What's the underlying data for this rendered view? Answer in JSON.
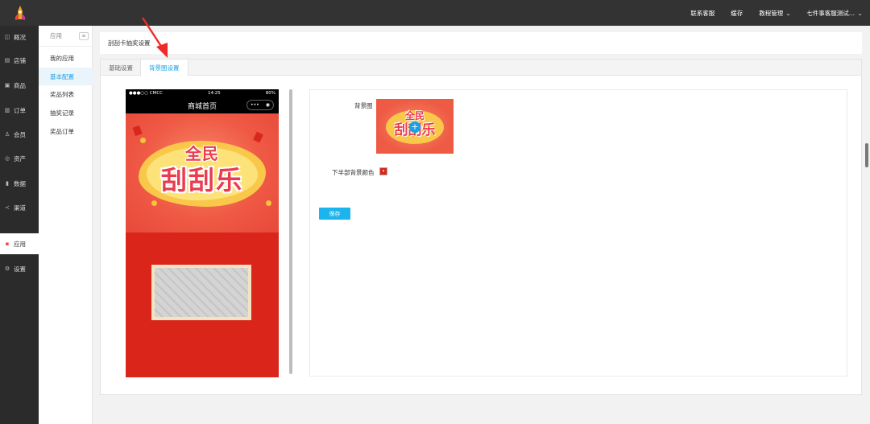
{
  "topbar": {
    "links": [
      "联系客服",
      "缓存",
      "教程管理",
      "七件事客服测试..."
    ]
  },
  "sidebar": {
    "items": [
      {
        "label": "概况",
        "icon": "overview-icon",
        "glyph": "◫"
      },
      {
        "label": "店铺",
        "icon": "store-icon",
        "glyph": "▤"
      },
      {
        "label": "商品",
        "icon": "goods-icon",
        "glyph": "▣"
      },
      {
        "label": "订单",
        "icon": "order-icon",
        "glyph": "▥"
      },
      {
        "label": "会员",
        "icon": "member-icon",
        "glyph": "♙"
      },
      {
        "label": "资产",
        "icon": "asset-icon",
        "glyph": "◎"
      },
      {
        "label": "数据",
        "icon": "data-icon",
        "glyph": "▮"
      },
      {
        "label": "渠道",
        "icon": "channel-icon",
        "glyph": "≺"
      },
      {
        "label": "应用",
        "icon": "apps-icon",
        "glyph": "▪",
        "active": true
      },
      {
        "label": "设置",
        "icon": "settings-icon",
        "glyph": "⚙"
      }
    ]
  },
  "subsidebar": {
    "title": "应用",
    "items": [
      "我的应用",
      "基本配置",
      "奖品列表",
      "抽奖记录",
      "奖品订单"
    ],
    "active_index": 1
  },
  "breadcrumb": "刮刮卡抽奖设置",
  "tabs": [
    "基础设置",
    "背景图设置"
  ],
  "active_tab": 1,
  "phone": {
    "carrier": "●●●○○ CMCC",
    "time": "14:25",
    "battery": "80%",
    "nav_title": "商城首页",
    "banner_line1": "全民",
    "banner_line2": "刮刮乐"
  },
  "form": {
    "background_label": "背景图",
    "thumb_line1": "全民",
    "thumb_line2": "刮刮乐",
    "bottom_color_label": "下半部背景颜色",
    "bottom_color": "#d9251a",
    "save_label": "保存"
  },
  "colors": {
    "accent": "#1aa0e6",
    "save_button": "#1cb4ec",
    "annotation_arrow": "#ee2a2a"
  }
}
